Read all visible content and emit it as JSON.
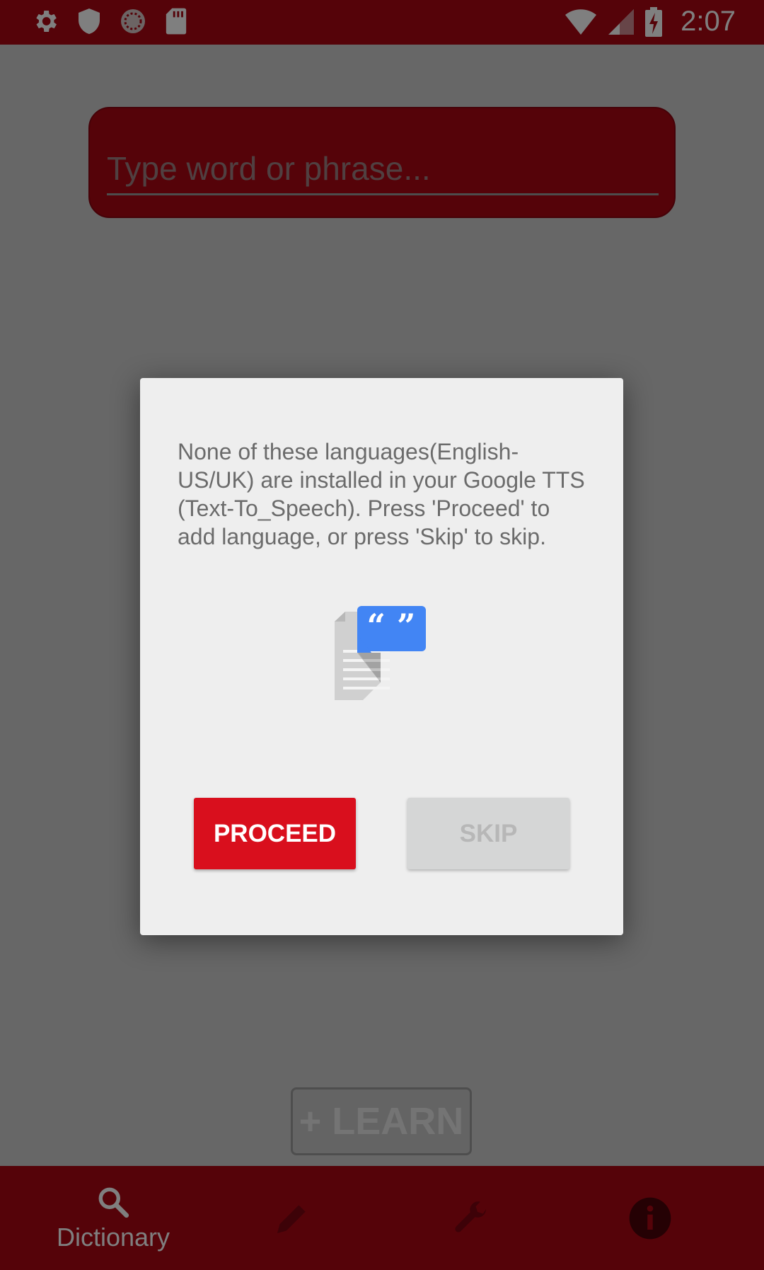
{
  "status_bar": {
    "time": "2:07",
    "left_icons": [
      "gear-icon",
      "shield-icon",
      "sync-icon",
      "sd-card-icon"
    ],
    "right_icons": [
      "wifi-icon",
      "signal-icon",
      "battery-charging-icon"
    ],
    "background": "#ab0612"
  },
  "search": {
    "placeholder": "Type word or phrase..."
  },
  "learn_button": {
    "label": "+ LEARN"
  },
  "bottom_nav": {
    "items": [
      {
        "label": "Dictionary",
        "icon": "search-icon"
      },
      {
        "label": "",
        "icon": "pencil-icon"
      },
      {
        "label": "",
        "icon": "wrench-icon"
      },
      {
        "label": "",
        "icon": "info-icon"
      }
    ]
  },
  "dialog": {
    "message": "None of these languages(English-US/UK) are installed in your Google TTS (Text-To_Speech). Press 'Proceed' to add language, or press 'Skip' to skip.",
    "icon": "google-tts-icon",
    "proceed_label": "PROCEED",
    "skip_label": "SKIP"
  },
  "colors": {
    "brand": "#ab0612",
    "proceed": "#d90f1d",
    "tts_blue": "#4285f4"
  }
}
